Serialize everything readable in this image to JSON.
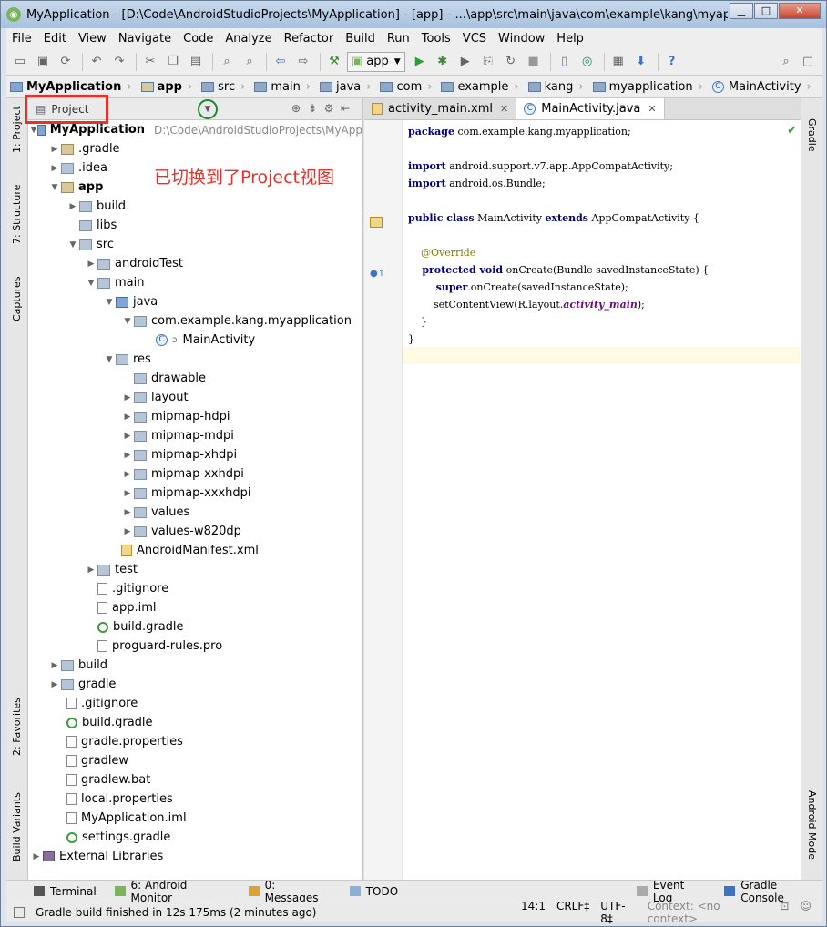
{
  "window": {
    "title": "MyApplication - [D:\\Code\\AndroidStudioProjects\\MyApplication] - [app] - ...\\app\\src\\main\\java\\com\\example\\kang\\myapplication\\..."
  },
  "menu": [
    "File",
    "Edit",
    "View",
    "Navigate",
    "Code",
    "Analyze",
    "Refactor",
    "Build",
    "Run",
    "Tools",
    "VCS",
    "Window",
    "Help"
  ],
  "toolbar": {
    "run_config": "app"
  },
  "breadcrumbs": [
    "MyApplication",
    "app",
    "src",
    "main",
    "java",
    "com",
    "example",
    "kang",
    "myapplication",
    "MainActivity"
  ],
  "left_tabs": {
    "project": "1: Project",
    "structure": "7: Structure",
    "captures": "Captures",
    "favorites": "2: Favorites",
    "build_variants": "Build Variants"
  },
  "right_tabs": {
    "gradle": "Gradle",
    "android_model": "Android Model"
  },
  "project_panel": {
    "view_label": "Project",
    "annotation": "已切换到了Project视图",
    "root_name": "MyApplication",
    "root_path": "D:\\Code\\AndroidStudioProjects\\MyApp",
    "tree": [
      {
        "label": ".gradle"
      },
      {
        "label": ".idea"
      },
      {
        "label": "app"
      },
      {
        "label": "build"
      },
      {
        "label": "libs"
      },
      {
        "label": "src"
      },
      {
        "label": "androidTest"
      },
      {
        "label": "main"
      },
      {
        "label": "java"
      },
      {
        "label": "com.example.kang.myapplication"
      },
      {
        "label": "MainActivity"
      },
      {
        "label": "res"
      },
      {
        "label": "drawable"
      },
      {
        "label": "layout"
      },
      {
        "label": "mipmap-hdpi"
      },
      {
        "label": "mipmap-mdpi"
      },
      {
        "label": "mipmap-xhdpi"
      },
      {
        "label": "mipmap-xxhdpi"
      },
      {
        "label": "mipmap-xxxhdpi"
      },
      {
        "label": "values"
      },
      {
        "label": "values-w820dp"
      },
      {
        "label": "AndroidManifest.xml"
      },
      {
        "label": "test"
      },
      {
        "label": ".gitignore"
      },
      {
        "label": "app.iml"
      },
      {
        "label": "build.gradle"
      },
      {
        "label": "proguard-rules.pro"
      },
      {
        "label": "build"
      },
      {
        "label": "gradle"
      },
      {
        "label": ".gitignore"
      },
      {
        "label": "build.gradle"
      },
      {
        "label": "gradle.properties"
      },
      {
        "label": "gradlew"
      },
      {
        "label": "gradlew.bat"
      },
      {
        "label": "local.properties"
      },
      {
        "label": "MyApplication.iml"
      },
      {
        "label": "settings.gradle"
      },
      {
        "label": "External Libraries"
      }
    ]
  },
  "editor": {
    "tabs": [
      {
        "label": "activity_main.xml"
      },
      {
        "label": "MainActivity.java"
      }
    ],
    "code": {
      "l1a": "package",
      "l1b": " com.example.kang.myapplication;",
      "l3a": "import",
      "l3b": " android.support.v7.app.AppCompatActivity;",
      "l4a": "import",
      "l4b": " android.os.Bundle;",
      "l6a": "public class",
      "l6b": " MainActivity ",
      "l6c": "extends",
      "l6d": " AppCompatActivity {",
      "l8": "    @Override",
      "l9a": "    protected void",
      "l9b": " onCreate(Bundle savedInstanceState) {",
      "l10a": "        super",
      "l10b": ".onCreate(savedInstanceState);",
      "l11a": "        setContentView(R.layout.",
      "l11b": "activity_main",
      "l11c": ");",
      "l12": "    }",
      "l13": "}"
    }
  },
  "bottom_tabs": {
    "terminal": "Terminal",
    "monitor": "6: Android Monitor",
    "messages": "0: Messages",
    "todo": "TODO",
    "event_log": "Event Log",
    "gradle_console": "Gradle Console"
  },
  "status": {
    "message": "Gradle build finished in 12s 175ms (2 minutes ago)",
    "position": "14:1",
    "line_sep": "CRLF‡",
    "encoding": "UTF-8‡",
    "context": "Context: <no context>"
  }
}
